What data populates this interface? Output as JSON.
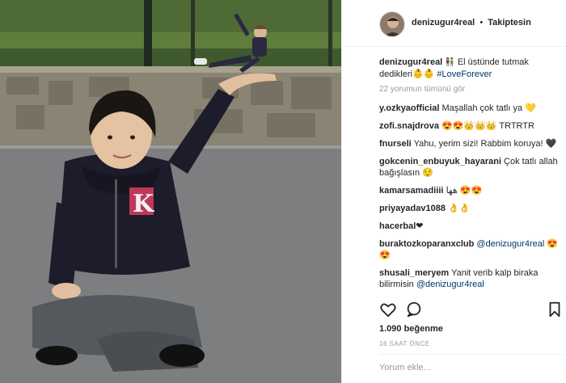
{
  "colors": {
    "link": "#003569",
    "muted": "#999999",
    "text": "#262626",
    "border": "#efefef"
  },
  "post": {
    "photo_icon": "photo-boy-holding-girl",
    "author": "denizugur4real",
    "follow_status": "Takiptesin",
    "separator": "•",
    "caption_user": "denizugur4real",
    "caption_emoji": "👫",
    "caption_text": " El üstünde tutmak dedikleri👶👶 ",
    "caption_hashtag": "#LoveForever",
    "view_all_comments": "22 yorumun tümünü gör",
    "likes": "1.090 beğenme",
    "timestamp": "16 SAAT ÖNCE",
    "comment_placeholder": "Yorum ekle..."
  },
  "comments": [
    {
      "user": "y.ozkyaofficial",
      "text": " Maşallah çok tatlı ya 💛",
      "mention": ""
    },
    {
      "user": "zofi.snajdrova",
      "text": " 😍😍👑👑👑 TRTRTR",
      "mention": ""
    },
    {
      "user": "fnurseli",
      "text": " Yahu, yerim sizi! Rabbim koruya! 🖤",
      "mention": ""
    },
    {
      "user": "gokcenin_enbuyuk_hayarani",
      "text": " Çok tatlı allah bağışlasın 😌",
      "mention": ""
    },
    {
      "user": "kamarsamadiiii",
      "text": " هها 😍😍",
      "mention": ""
    },
    {
      "user": "priyayadav1088",
      "text": " 👌👌",
      "mention": ""
    },
    {
      "user": "hacerbal",
      "text": "❤",
      "mention": ""
    },
    {
      "user": "buraktozkoparanxclub",
      "text": " ",
      "mention": "@denizugur4real",
      "after": " 😍😍"
    },
    {
      "user": "shusali_meryem",
      "text": " Yanit verib kalp biraka bilirmisin ",
      "mention": "@denizugur4real",
      "after": ""
    },
    {
      "user": "shusali_meryem",
      "text": " 😍😍",
      "mention": ""
    }
  ],
  "icons": {
    "like": "heart-outline-icon",
    "comment": "speech-bubble-icon",
    "save": "bookmark-icon"
  }
}
